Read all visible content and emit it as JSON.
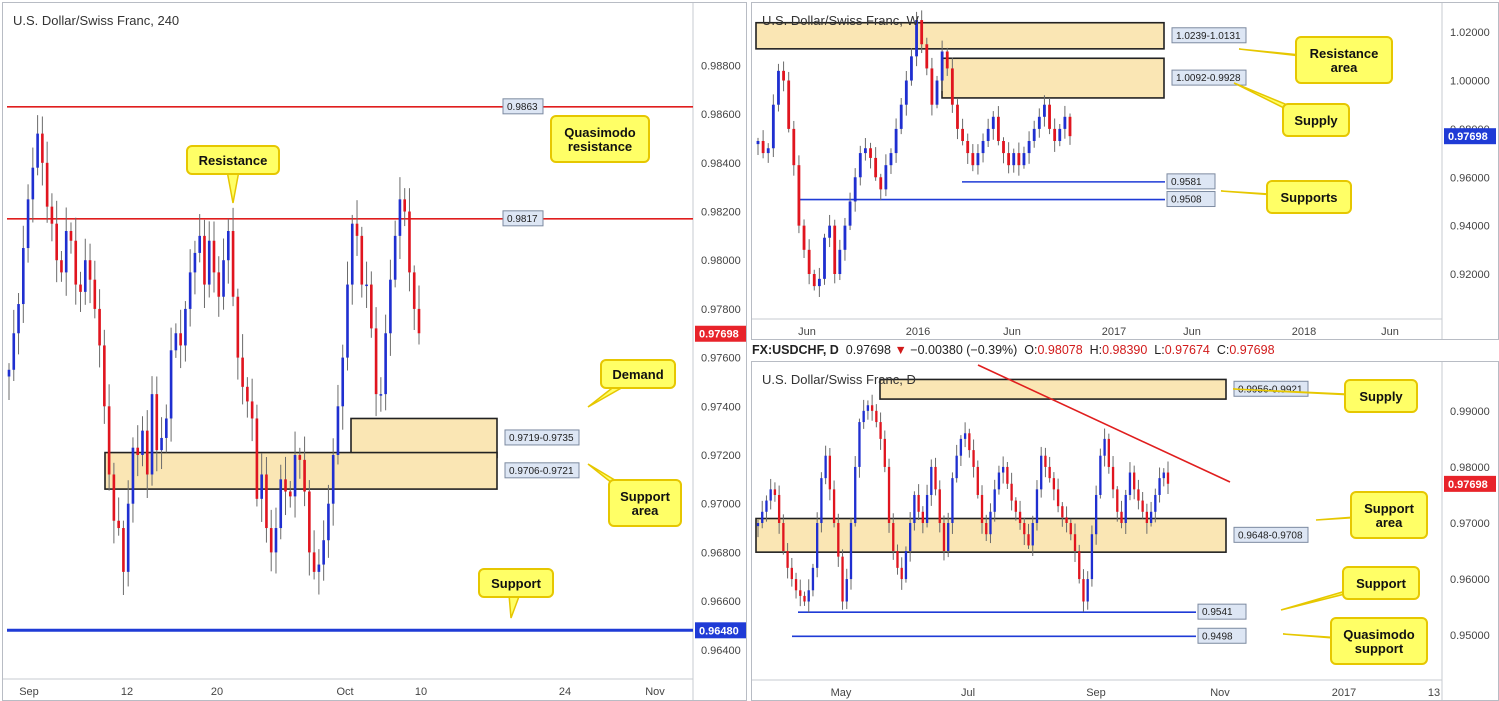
{
  "ohlc_bar": {
    "symbol": "FX:USDCHF, D",
    "price": "0.97698",
    "change": "−0.00380 (−0.39%)",
    "o_label": "O:",
    "o": "0.98078",
    "h_label": "H:",
    "h": "0.98390",
    "l_label": "L:",
    "l": "0.97674",
    "c_label": "C:",
    "c": "0.97698"
  },
  "colors": {
    "bull": "#1f2fd0",
    "bear": "#e0151f",
    "zone": "#fae6b4",
    "resistance_line": "#e01e1e",
    "support_line": "#1f3bd6",
    "callout": "#ffff66",
    "price_tag": "#e8232a",
    "price_tag_blue": "#1f3bd6"
  },
  "chart_data": [
    {
      "type": "candlestick",
      "title": "U.S. Dollar/Swiss Franc, 240",
      "y_ticks": [
        "0.98800",
        "0.98600",
        "0.98400",
        "0.98200",
        "0.98000",
        "0.97800",
        "0.97600",
        "0.97400",
        "0.97200",
        "0.97000",
        "0.96800",
        "0.96600",
        "0.96400"
      ],
      "ylim": [
        0.9628,
        0.9904
      ],
      "x_ticks": [
        "Sep",
        "12",
        "20",
        "Oct",
        "10",
        "24",
        "Nov"
      ],
      "last_price": "0.97698",
      "close_series": [
        0.9755,
        0.977,
        0.9782,
        0.9805,
        0.9825,
        0.9838,
        0.9852,
        0.984,
        0.9822,
        0.9815,
        0.98,
        0.9795,
        0.9812,
        0.9808,
        0.979,
        0.9787,
        0.98,
        0.9792,
        0.978,
        0.9765,
        0.974,
        0.9712,
        0.9693,
        0.969,
        0.9672,
        0.97,
        0.9723,
        0.972,
        0.973,
        0.9712,
        0.9745,
        0.9722,
        0.9727,
        0.9735,
        0.9763,
        0.977,
        0.9765,
        0.978,
        0.9795,
        0.9803,
        0.981,
        0.979,
        0.9808,
        0.9795,
        0.9785,
        0.98,
        0.9812,
        0.9785,
        0.976,
        0.9748,
        0.9742,
        0.9735,
        0.9702,
        0.9712,
        0.969,
        0.968,
        0.969,
        0.971,
        0.9705,
        0.9703,
        0.972,
        0.9718,
        0.9705,
        0.968,
        0.9672,
        0.9675,
        0.9685,
        0.97,
        0.972,
        0.974,
        0.976,
        0.979,
        0.9815,
        0.981,
        0.979,
        0.979,
        0.9772,
        0.9745,
        0.9745,
        0.977,
        0.9792,
        0.981,
        0.9825,
        0.982,
        0.9795,
        0.978,
        0.977
      ],
      "levels": [
        {
          "value": 0.9863,
          "label": "0.9863",
          "kind": "resistance"
        },
        {
          "value": 0.9817,
          "label": "0.9817",
          "kind": "resistance"
        },
        {
          "value": 0.9648,
          "label": "0.96480",
          "kind": "support"
        }
      ],
      "zones": [
        {
          "low": 0.9719,
          "high": 0.9735,
          "label": "0.9719-0.9735"
        },
        {
          "low": 0.9706,
          "high": 0.9721,
          "label": "0.9706-0.9721"
        }
      ],
      "callouts": [
        {
          "lines": [
            "Quasimodo",
            "resistance"
          ]
        },
        {
          "lines": [
            "Resistance"
          ]
        },
        {
          "lines": [
            "Demand"
          ]
        },
        {
          "lines": [
            "Support",
            "area"
          ]
        },
        {
          "lines": [
            "Support"
          ]
        }
      ]
    },
    {
      "type": "candlestick",
      "title": "U.S. Dollar/Swiss Franc, W",
      "y_ticks": [
        "1.02000",
        "1.00000",
        "0.98000",
        "0.96000",
        "0.94000",
        "0.92000"
      ],
      "ylim": [
        0.9014,
        1.0304
      ],
      "x_ticks": [
        "Jun",
        "2016",
        "Jun",
        "2017",
        "Jun",
        "2018",
        "Jun"
      ],
      "last_price": "0.97698",
      "close_series": [
        0.975,
        0.97,
        0.972,
        0.99,
        1.004,
        1.0,
        0.98,
        0.965,
        0.94,
        0.93,
        0.92,
        0.915,
        0.918,
        0.935,
        0.94,
        0.92,
        0.93,
        0.94,
        0.95,
        0.96,
        0.97,
        0.972,
        0.968,
        0.96,
        0.955,
        0.965,
        0.97,
        0.98,
        0.99,
        1.0,
        1.01,
        1.025,
        1.015,
        1.005,
        0.99,
        1.0,
        1.012,
        1.005,
        0.99,
        0.98,
        0.975,
        0.97,
        0.965,
        0.97,
        0.975,
        0.98,
        0.985,
        0.975,
        0.97,
        0.965,
        0.97,
        0.965,
        0.97,
        0.975,
        0.98,
        0.985,
        0.99,
        0.98,
        0.975,
        0.98,
        0.985,
        0.977
      ],
      "levels": [
        {
          "value": 0.9581,
          "label": "0.9581",
          "kind": "support"
        },
        {
          "value": 0.9508,
          "label": "0.9508",
          "kind": "support"
        }
      ],
      "zones": [
        {
          "low": 1.0131,
          "high": 1.0239,
          "label": "1.0239-1.0131"
        },
        {
          "low": 0.9928,
          "high": 1.0092,
          "label": "1.0092-0.9928"
        }
      ],
      "callouts": [
        {
          "lines": [
            "Resistance",
            "area"
          ]
        },
        {
          "lines": [
            "Supply"
          ]
        },
        {
          "lines": [
            "Supports"
          ]
        }
      ]
    },
    {
      "type": "candlestick",
      "title": "U.S. Dollar/Swiss Franc, D",
      "y_ticks": [
        "0.99000",
        "0.98000",
        "0.97000",
        "0.96000",
        "0.95000"
      ],
      "ylim": [
        0.942,
        0.998
      ],
      "x_ticks": [
        "May",
        "Jul",
        "Sep",
        "Nov",
        "2017",
        "13"
      ],
      "last_price": "0.97698",
      "close_series": [
        0.97,
        0.972,
        0.974,
        0.976,
        0.975,
        0.97,
        0.965,
        0.962,
        0.96,
        0.958,
        0.957,
        0.956,
        0.958,
        0.962,
        0.97,
        0.978,
        0.982,
        0.976,
        0.97,
        0.964,
        0.956,
        0.96,
        0.97,
        0.98,
        0.988,
        0.99,
        0.991,
        0.99,
        0.988,
        0.985,
        0.98,
        0.97,
        0.965,
        0.962,
        0.96,
        0.965,
        0.97,
        0.975,
        0.972,
        0.97,
        0.975,
        0.98,
        0.976,
        0.97,
        0.965,
        0.97,
        0.978,
        0.982,
        0.985,
        0.986,
        0.983,
        0.98,
        0.975,
        0.97,
        0.968,
        0.972,
        0.976,
        0.979,
        0.98,
        0.977,
        0.974,
        0.972,
        0.97,
        0.968,
        0.966,
        0.97,
        0.976,
        0.982,
        0.98,
        0.978,
        0.976,
        0.973,
        0.971,
        0.97,
        0.968,
        0.965,
        0.96,
        0.956,
        0.96,
        0.968,
        0.975,
        0.982,
        0.985,
        0.98,
        0.976,
        0.972,
        0.97,
        0.975,
        0.979,
        0.976,
        0.974,
        0.972,
        0.97,
        0.972,
        0.975,
        0.978,
        0.979,
        0.977
      ],
      "levels": [
        {
          "value": 0.9541,
          "label": "0.9541",
          "kind": "support"
        },
        {
          "value": 0.9498,
          "label": "0.9498",
          "kind": "support"
        }
      ],
      "zones": [
        {
          "low": 0.9921,
          "high": 0.9956,
          "label": "0.9956-0.9921"
        },
        {
          "low": 0.9648,
          "high": 0.9708,
          "label": "0.9648-0.9708"
        }
      ],
      "callouts": [
        {
          "lines": [
            "Supply"
          ]
        },
        {
          "lines": [
            "Support",
            "area"
          ]
        },
        {
          "lines": [
            "Support"
          ]
        },
        {
          "lines": [
            "Quasimodo",
            "support"
          ]
        }
      ]
    }
  ]
}
